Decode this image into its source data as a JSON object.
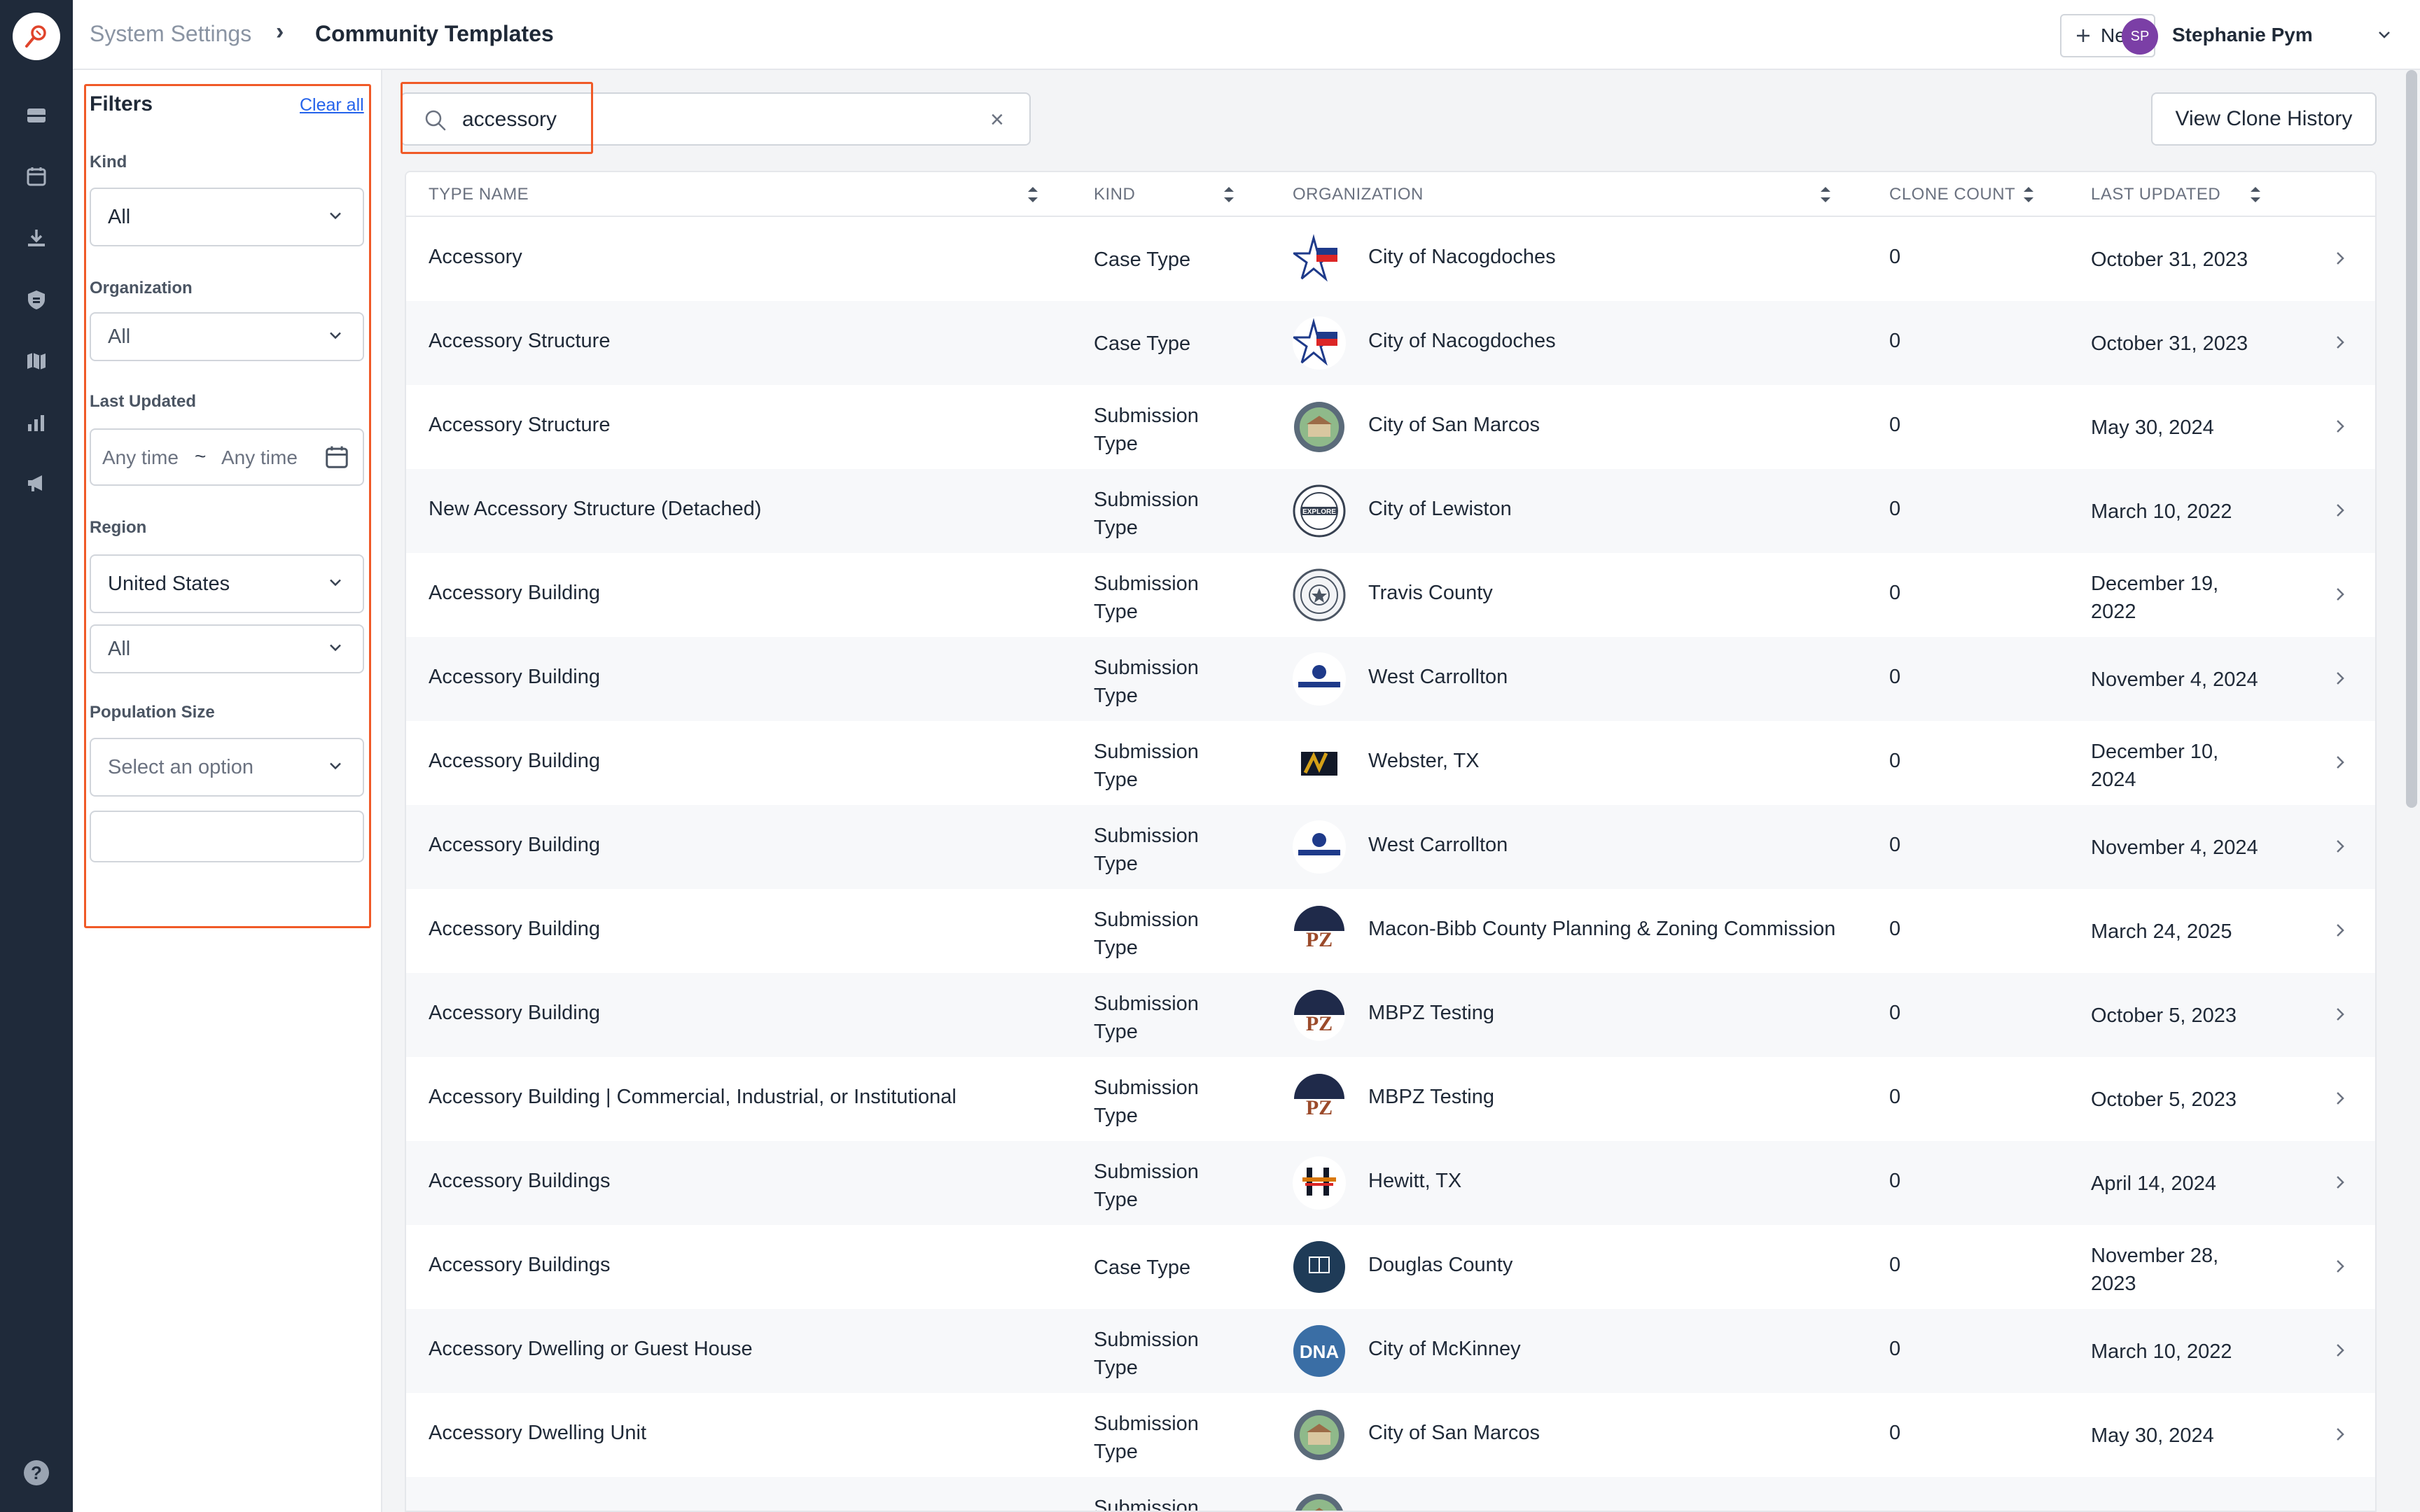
{
  "breadcrumb": {
    "root": "System Settings",
    "current": "Community Templates"
  },
  "header": {
    "new_label": "New",
    "user_initials": "SP",
    "user_name": "Stephanie Pym"
  },
  "filters": {
    "title": "Filters",
    "clear_all": "Clear all",
    "kind": {
      "label": "Kind",
      "value": "All"
    },
    "organization": {
      "label": "Organization",
      "value": "All"
    },
    "last_updated": {
      "label": "Last Updated",
      "from": "Any time",
      "separator": "~",
      "to": "Any time"
    },
    "region": {
      "label": "Region",
      "value": "United States",
      "subvalue": "All"
    },
    "population_size": {
      "label": "Population Size",
      "placeholder": "Select an option",
      "extra_value": ""
    }
  },
  "search": {
    "value": "accessory",
    "clear_symbol": "×"
  },
  "clone_history_label": "View Clone History",
  "table": {
    "columns": [
      "TYPE NAME",
      "KIND",
      "ORGANIZATION",
      "CLONE COUNT",
      "LAST UPDATED"
    ],
    "rows": [
      {
        "name": "Accessory",
        "kind": [
          "Case Type"
        ],
        "org": "City of Nacogdoches",
        "logo": "star-flag",
        "count": "0",
        "date": [
          "October 31, 2023"
        ]
      },
      {
        "name": "Accessory Structure",
        "kind": [
          "Case Type"
        ],
        "org": "City of Nacogdoches",
        "logo": "star-flag",
        "count": "0",
        "date": [
          "October 31, 2023"
        ]
      },
      {
        "name": "Accessory Structure",
        "kind": [
          "Submission",
          "Type"
        ],
        "org": "City of San Marcos",
        "logo": "city-seal",
        "count": "0",
        "date": [
          "May 30, 2024"
        ]
      },
      {
        "name": "New Accessory Structure (Detached)",
        "kind": [
          "Submission",
          "Type"
        ],
        "org": "City of Lewiston",
        "logo": "explore-seal",
        "count": "0",
        "date": [
          "March 10, 2022"
        ]
      },
      {
        "name": "Accessory Building",
        "kind": [
          "Submission",
          "Type"
        ],
        "org": "Travis County",
        "logo": "county-seal",
        "count": "0",
        "date": [
          "December 19,",
          "2022"
        ]
      },
      {
        "name": "Accessory Building",
        "kind": [
          "Submission",
          "Type"
        ],
        "org": "West Carrollton",
        "logo": "west-carrollton",
        "count": "0",
        "date": [
          "November 4, 2024"
        ]
      },
      {
        "name": "Accessory Building",
        "kind": [
          "Submission",
          "Type"
        ],
        "org": "Webster, TX",
        "logo": "webster",
        "count": "0",
        "date": [
          "December 10,",
          "2024"
        ]
      },
      {
        "name": "Accessory Building",
        "kind": [
          "Submission",
          "Type"
        ],
        "org": "West Carrollton",
        "logo": "west-carrollton",
        "count": "0",
        "date": [
          "November 4, 2024"
        ]
      },
      {
        "name": "Accessory Building",
        "kind": [
          "Submission",
          "Type"
        ],
        "org": "Macon-Bibb County Planning & Zoning Commission",
        "logo": "pz",
        "count": "0",
        "date": [
          "March 24, 2025"
        ]
      },
      {
        "name": "Accessory Building",
        "kind": [
          "Submission",
          "Type"
        ],
        "org": "MBPZ Testing",
        "logo": "pz",
        "count": "0",
        "date": [
          "October 5, 2023"
        ]
      },
      {
        "name": "Accessory Building | Commercial, Industrial, or Institutional",
        "kind": [
          "Submission",
          "Type"
        ],
        "org": "MBPZ Testing",
        "logo": "pz",
        "count": "0",
        "date": [
          "October 5, 2023"
        ]
      },
      {
        "name": "Accessory Buildings",
        "kind": [
          "Submission",
          "Type"
        ],
        "org": "Hewitt, TX",
        "logo": "hewitt",
        "count": "0",
        "date": [
          "April 14, 2024"
        ]
      },
      {
        "name": "Accessory Buildings",
        "kind": [
          "Case Type"
        ],
        "org": "Douglas County",
        "logo": "douglas",
        "count": "0",
        "date": [
          "November 28,",
          "2023"
        ]
      },
      {
        "name": "Accessory Dwelling or Guest House",
        "kind": [
          "Submission",
          "Type"
        ],
        "org": "City of McKinney",
        "logo": "dna",
        "count": "0",
        "date": [
          "March 10, 2022"
        ]
      },
      {
        "name": "Accessory Dwelling Unit",
        "kind": [
          "Submission",
          "Type"
        ],
        "org": "City of San Marcos",
        "logo": "city-seal",
        "count": "0",
        "date": [
          "May 30, 2024"
        ]
      },
      {
        "name": "",
        "kind": [
          "Submission",
          ""
        ],
        "org": "",
        "logo": "city-seal",
        "count": "",
        "date": [
          ""
        ]
      }
    ]
  },
  "icons": {
    "nav": [
      "inbox-icon",
      "calendar-icon",
      "download-icon",
      "shield-icon",
      "map-icon",
      "bar-chart-icon",
      "megaphone-icon"
    ],
    "help": "?"
  },
  "colors": {
    "rail": "#1f2a3a",
    "highlight": "#f05a28",
    "link": "#2563eb",
    "avatar": "#7b3fa6"
  }
}
